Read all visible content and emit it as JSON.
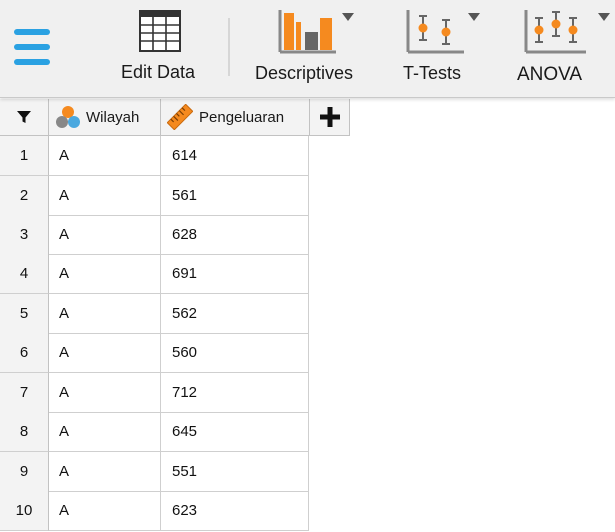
{
  "toolbar": {
    "edit_data": "Edit Data",
    "descriptives": "Descriptives",
    "ttests": "T-Tests",
    "anova": "ANOVA"
  },
  "columns": [
    {
      "name": "Wilayah",
      "type_icon": "nominal-icon"
    },
    {
      "name": "Pengeluaran",
      "type_icon": "scale-ruler-icon"
    }
  ],
  "rows": [
    {
      "n": "1",
      "wilayah": "A",
      "pengeluaran": "614"
    },
    {
      "n": "2",
      "wilayah": "A",
      "pengeluaran": "561"
    },
    {
      "n": "3",
      "wilayah": "A",
      "pengeluaran": "628"
    },
    {
      "n": "4",
      "wilayah": "A",
      "pengeluaran": "691"
    },
    {
      "n": "5",
      "wilayah": "A",
      "pengeluaran": "562"
    },
    {
      "n": "6",
      "wilayah": "A",
      "pengeluaran": "560"
    },
    {
      "n": "7",
      "wilayah": "A",
      "pengeluaran": "712"
    },
    {
      "n": "8",
      "wilayah": "A",
      "pengeluaran": "645"
    },
    {
      "n": "9",
      "wilayah": "A",
      "pengeluaran": "551"
    },
    {
      "n": "10",
      "wilayah": "A",
      "pengeluaran": "623"
    }
  ],
  "colors": {
    "accent_blue": "#2aa1e2",
    "analysis_orange": "#f58a1f"
  }
}
